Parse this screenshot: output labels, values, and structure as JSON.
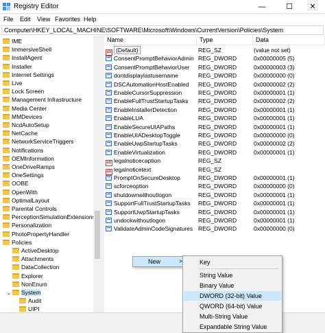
{
  "window": {
    "title": "Registry Editor",
    "min_glyph": "—",
    "max_glyph": "☐",
    "close_glyph": "✕"
  },
  "menu": [
    "File",
    "Edit",
    "View",
    "Favorites",
    "Help"
  ],
  "address": "Computer\\HKEY_LOCAL_MACHINE\\SOFTWARE\\Microsoft\\Windows\\CurrentVersion\\Policies\\System",
  "tree": {
    "items": [
      "IME",
      "ImmersiveShell",
      "InstallAgent",
      "Installer",
      "Internet Settings",
      "Live",
      "Lock Screen",
      "Management Infrastructure",
      "Media Center",
      "MMDevices",
      "NcdAutoSetup",
      "NetCache",
      "NetworkServiceTriggers",
      "Notifications",
      "OEMInformation",
      "OneDriveRamps",
      "OneSettings",
      "OOBE",
      "OpenWith",
      "OptimalLayout",
      "Parental Controls",
      "PerceptionSimulationExtensions",
      "Personalization",
      "PhotoPropertyHandler",
      "Policies"
    ],
    "policies_children": [
      "ActiveDesktop",
      "Attachments",
      "DataCollection",
      "Explorer",
      "NonEnum",
      "System"
    ],
    "system_children": [
      "Audit",
      "UIPI"
    ]
  },
  "columns": {
    "name": "Name",
    "type": "Type",
    "data": "Data"
  },
  "values": [
    {
      "name": "(Default)",
      "type": "REG_SZ",
      "data": "(value not set)",
      "icon": "string-value-icon"
    },
    {
      "name": "ConsentPromptBehaviorAdmin",
      "type": "REG_DWORD",
      "data": "0x00000005 (5)",
      "icon": "dword-value-icon"
    },
    {
      "name": "ConsentPromptBehaviorUser",
      "type": "REG_DWORD",
      "data": "0x00000003 (3)",
      "icon": "dword-value-icon"
    },
    {
      "name": "dontdisplaylastusername",
      "type": "REG_DWORD",
      "data": "0x00000000 (0)",
      "icon": "dword-value-icon"
    },
    {
      "name": "DSCAutomationHostEnabled",
      "type": "REG_DWORD",
      "data": "0x00000002 (2)",
      "icon": "dword-value-icon"
    },
    {
      "name": "EnableCursorSuppression",
      "type": "REG_DWORD",
      "data": "0x00000001 (1)",
      "icon": "dword-value-icon"
    },
    {
      "name": "EnableFullTrustStartupTasks",
      "type": "REG_DWORD",
      "data": "0x00000002 (2)",
      "icon": "dword-value-icon"
    },
    {
      "name": "EnableInstallerDetection",
      "type": "REG_DWORD",
      "data": "0x00000001 (1)",
      "icon": "dword-value-icon"
    },
    {
      "name": "EnableLUA",
      "type": "REG_DWORD",
      "data": "0x00000001 (1)",
      "icon": "dword-value-icon"
    },
    {
      "name": "EnableSecureUIAPaths",
      "type": "REG_DWORD",
      "data": "0x00000001 (1)",
      "icon": "dword-value-icon"
    },
    {
      "name": "EnableUIADesktopToggle",
      "type": "REG_DWORD",
      "data": "0x00000000 (0)",
      "icon": "dword-value-icon"
    },
    {
      "name": "EnableUwpStartupTasks",
      "type": "REG_DWORD",
      "data": "0x00000002 (2)",
      "icon": "dword-value-icon"
    },
    {
      "name": "EnableVirtualization",
      "type": "REG_DWORD",
      "data": "0x00000001 (1)",
      "icon": "dword-value-icon"
    },
    {
      "name": "legalnoticecaption",
      "type": "REG_SZ",
      "data": "",
      "icon": "string-value-icon"
    },
    {
      "name": "legalnoticetext",
      "type": "REG_SZ",
      "data": "",
      "icon": "string-value-icon"
    },
    {
      "name": "PromptOnSecureDesktop",
      "type": "REG_DWORD",
      "data": "0x00000001 (1)",
      "icon": "dword-value-icon"
    },
    {
      "name": "scforceoption",
      "type": "REG_DWORD",
      "data": "0x00000000 (0)",
      "icon": "dword-value-icon"
    },
    {
      "name": "shutdownwithoutlogon",
      "type": "REG_DWORD",
      "data": "0x00000001 (1)",
      "icon": "dword-value-icon"
    },
    {
      "name": "SupportFullTrustStartupTasks",
      "type": "REG_DWORD",
      "data": "0x00000001 (1)",
      "icon": "dword-value-icon"
    },
    {
      "name": "SupportUwpStartupTasks",
      "type": "REG_DWORD",
      "data": "0x00000001 (1)",
      "icon": "dword-value-icon"
    },
    {
      "name": "undockwithoutlogon",
      "type": "REG_DWORD",
      "data": "0x00000001 (1)",
      "icon": "dword-value-icon"
    },
    {
      "name": "ValidateAdminCodeSignatures",
      "type": "REG_DWORD",
      "data": "0x00000000 (0)",
      "icon": "dword-value-icon"
    }
  ],
  "context_menu": {
    "new_label": "New",
    "new_arrow": ">",
    "submenu": [
      "Key",
      "String Value",
      "Binary Value",
      "DWORD (32-bit) Value",
      "QWORD (64-bit) Value",
      "Multi-String Value",
      "Expandable String Value"
    ],
    "highlighted": "DWORD (32-bit) Value"
  },
  "colors": {
    "selection": "#cce8ff",
    "folder": "#f0c64d"
  }
}
